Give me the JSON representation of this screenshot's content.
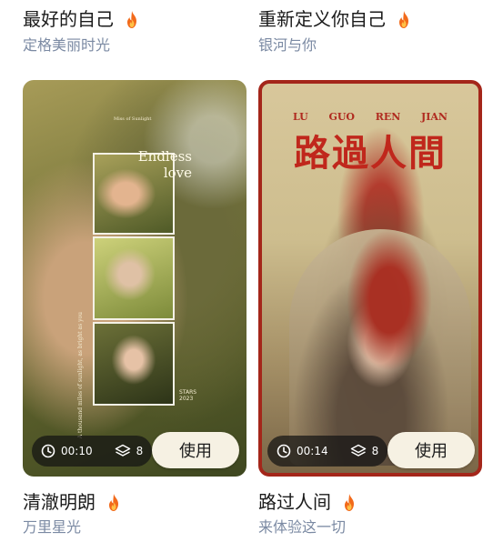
{
  "cards": [
    {
      "title": "最好的自己",
      "subtitle": "定格美丽时光",
      "icon": "flame-icon"
    },
    {
      "title": "重新定义你自己",
      "subtitle": "银河与你",
      "icon": "flame-icon"
    },
    {
      "title": "清澈明朗",
      "subtitle": "万里星光",
      "icon": "flame-icon",
      "duration": "00:10",
      "layers": "8",
      "button": "使用",
      "overlay": {
        "top_line": "Miss of Sunlight",
        "heading_line1": "Endless",
        "heading_line2": "love",
        "vertical": "A thousand miles of sunlight, as bright as you",
        "corner_line1": "STARS",
        "corner_line2": "2023"
      }
    },
    {
      "title": "路过人间",
      "subtitle": "来体验这一切",
      "icon": "flame-icon",
      "duration": "00:14",
      "layers": "8",
      "button": "使用",
      "overlay": {
        "pinyin": [
          "LU",
          "GUO",
          "REN",
          "JIAN"
        ],
        "heading": "路過人間"
      }
    }
  ],
  "colors": {
    "title": "#1b1b1b",
    "subtitle": "#7b8aa3",
    "flame": "#f26a1b",
    "accent_red": "#c0271c",
    "button_bg": "#f6f1e3"
  }
}
